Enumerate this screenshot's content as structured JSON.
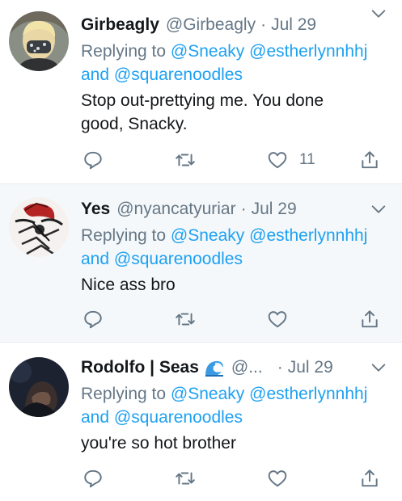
{
  "tweets": [
    {
      "name": "Girbeagly",
      "handle": "@Girbeagly",
      "separator": "·",
      "time": "Jul 29",
      "replying_prefix": "Replying to",
      "mention1": "@Sneaky",
      "mention2": "@estherlynnhhj",
      "and_word": "and",
      "mention3": "@squarenoodles",
      "text_line1": "Stop out-prettying me. You done",
      "text_line2": "good, Snacky.",
      "like_count": "11"
    },
    {
      "name": "Yes",
      "handle": "@nyancatyuriar",
      "separator": "·",
      "time": "Jul 29",
      "replying_prefix": "Replying to",
      "mention1": "@Sneaky",
      "mention2": "@estherlynnhhj",
      "and_word": "and",
      "mention3": "@squarenoodles",
      "text_line1": "Nice ass bro",
      "like_count": ""
    },
    {
      "name": "Rodolfo | Seas",
      "handle": "@...",
      "separator": "·",
      "time": "Jul 29",
      "replying_prefix": "Replying to",
      "mention1": "@Sneaky",
      "mention2": "@estherlynnhhj",
      "and_word": "and",
      "mention3": "@squarenoodles",
      "text_line1": "you're so hot brother",
      "like_count": ""
    }
  ],
  "icons": {
    "reply": "reply-icon",
    "retweet": "retweet-icon",
    "like": "heart-icon",
    "share": "share-icon",
    "more": "chevron-down-icon",
    "emoji": "water-wave-emoji"
  },
  "colors": {
    "link": "#1da1f2",
    "muted": "#657786",
    "text": "#14171a",
    "highlight_bg": "#f5f8fa",
    "border": "#e6ecf0"
  }
}
